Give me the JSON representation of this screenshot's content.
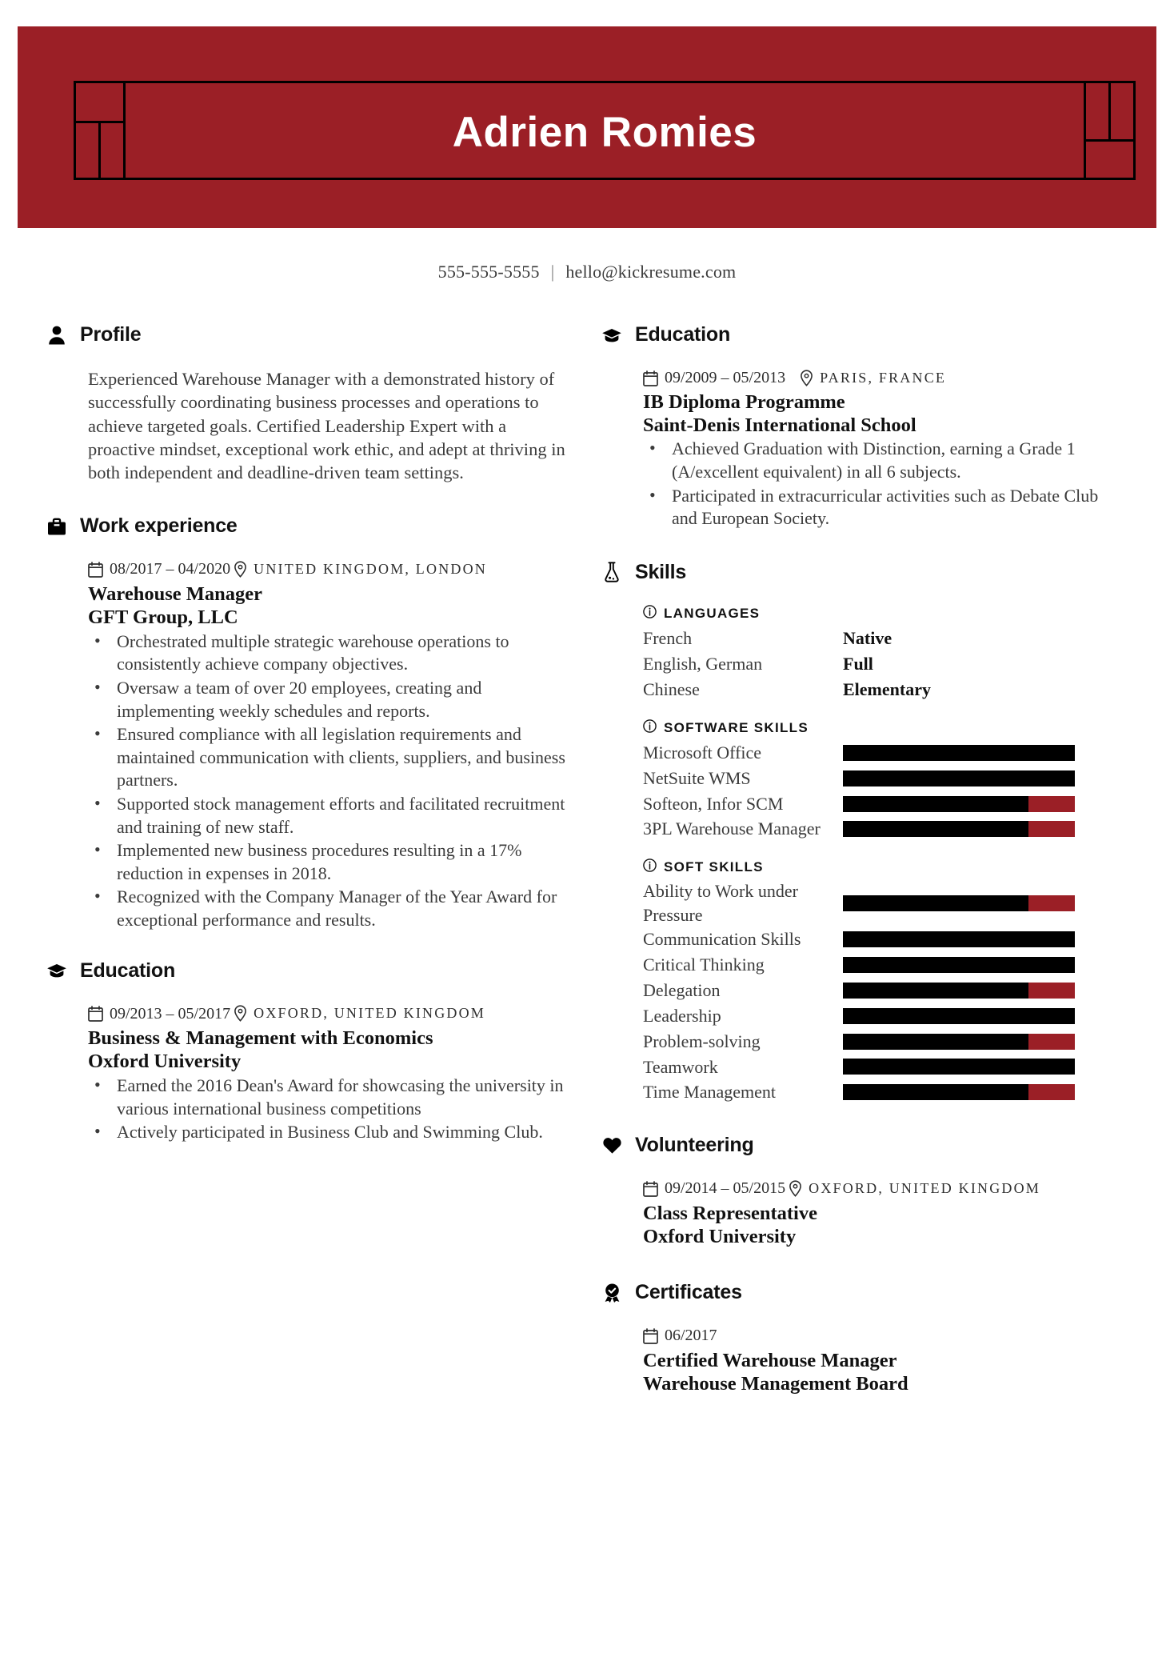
{
  "theme": {
    "accent": "#9b1f26",
    "bar_fill": "#000000",
    "text": "#3b3b3b"
  },
  "header": {
    "name": "Adrien Romies",
    "phone": "555-555-5555",
    "separator": "|",
    "email": "hello@kickresume.com"
  },
  "left": {
    "profile": {
      "icon": "person-icon",
      "title": "Profile",
      "text": "Experienced Warehouse Manager with a demonstrated history of successfully coordinating business processes and operations to achieve targeted goals. Certified Leadership Expert with a proactive mindset, exceptional work ethic, and adept at thriving in both independent and deadline-driven team settings."
    },
    "work": {
      "icon": "briefcase-icon",
      "title": "Work experience",
      "entries": [
        {
          "date": "08/2017 – 04/2020",
          "location": "United Kingdom, London",
          "title": "Warehouse Manager",
          "org": "GFT Group, LLC",
          "bullets": [
            "Orchestrated multiple strategic warehouse operations to consistently achieve company objectives.",
            "Oversaw a team of over 20 employees, creating and implementing weekly schedules and reports.",
            "Ensured compliance with all legislation requirements and maintained communication with clients, suppliers, and business partners.",
            "Supported stock management efforts and facilitated recruitment and training of new staff.",
            "Implemented new business procedures resulting in a 17% reduction in expenses in 2018.",
            "Recognized with the Company Manager of the Year Award for exceptional performance and results."
          ]
        }
      ]
    },
    "education": {
      "icon": "graduation-cap-icon",
      "title": "Education",
      "entries": [
        {
          "date": "09/2013 – 05/2017",
          "location": "Oxford, United Kingdom",
          "title": "Business & Management with Economics",
          "org": "Oxford University",
          "bullets": [
            "Earned the 2016 Dean's Award for showcasing the university in various international business competitions",
            "Actively participated in Business Club and Swimming Club."
          ]
        }
      ]
    }
  },
  "right": {
    "education": {
      "icon": "graduation-cap-icon",
      "title": "Education",
      "entries": [
        {
          "date": "09/2009 – 05/2013",
          "location": "Paris, France",
          "title": "IB Diploma Programme",
          "org": "Saint-Denis International School",
          "bullets": [
            "Achieved Graduation with Distinction, earning a Grade 1 (A/excellent equivalent) in all 6 subjects.",
            "Participated in extracurricular activities such as Debate Club and European Society."
          ]
        }
      ]
    },
    "skills": {
      "icon": "flask-icon",
      "title": "Skills",
      "groups": [
        {
          "label": "Languages",
          "type": "levels",
          "items": [
            {
              "name": "French",
              "level": "Native"
            },
            {
              "name": "English, German",
              "level": "Full"
            },
            {
              "name": "Chinese",
              "level": "Elementary"
            }
          ]
        },
        {
          "label": "Software Skills",
          "type": "bars",
          "items": [
            {
              "name": "Microsoft Office",
              "value": 100
            },
            {
              "name": "NetSuite WMS",
              "value": 100
            },
            {
              "name": "Softeon, Infor SCM",
              "value": 80
            },
            {
              "name": "3PL Warehouse Manager",
              "value": 80
            }
          ]
        },
        {
          "label": "Soft Skills",
          "type": "bars",
          "items": [
            {
              "name": "Ability to Work under Pressure",
              "value": 80
            },
            {
              "name": "Communication Skills",
              "value": 100
            },
            {
              "name": "Critical Thinking",
              "value": 100
            },
            {
              "name": "Delegation",
              "value": 80
            },
            {
              "name": "Leadership",
              "value": 100
            },
            {
              "name": "Problem-solving",
              "value": 80
            },
            {
              "name": "Teamwork",
              "value": 100
            },
            {
              "name": "Time Management",
              "value": 80
            }
          ]
        }
      ]
    },
    "volunteering": {
      "icon": "heart-icon",
      "title": "Volunteering",
      "entries": [
        {
          "date": "09/2014 – 05/2015",
          "location": "Oxford, United Kingdom",
          "title": "Class Representative",
          "org": "Oxford University",
          "bullets": []
        }
      ]
    },
    "certificates": {
      "icon": "award-badge-icon",
      "title": "Certificates",
      "entries": [
        {
          "date": "06/2017",
          "location": "",
          "title": "Certified Warehouse Manager",
          "org": "Warehouse Management Board",
          "bullets": []
        }
      ]
    }
  }
}
